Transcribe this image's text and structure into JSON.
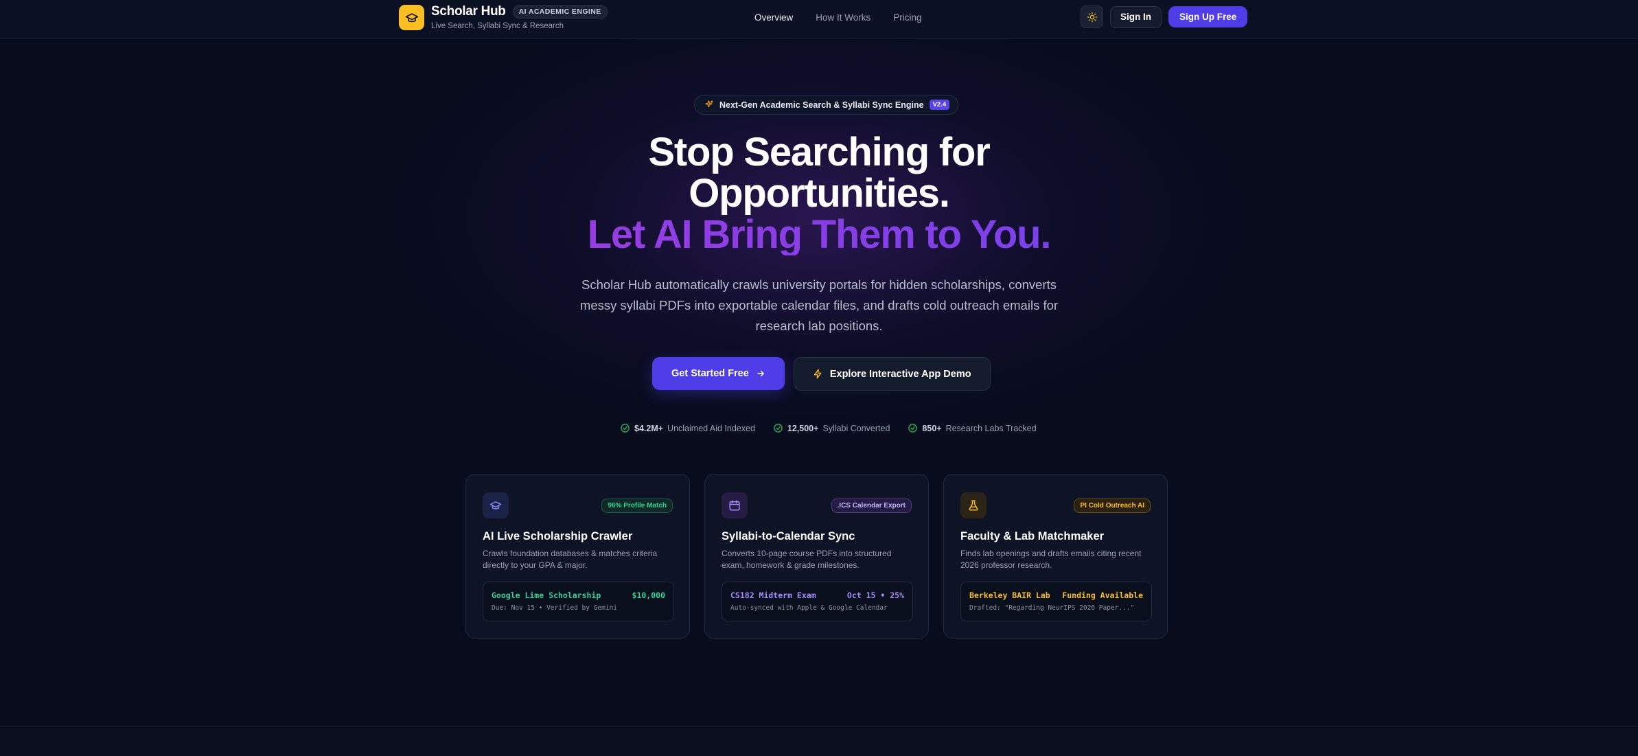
{
  "nav": {
    "brand_name": "Scholar Hub",
    "brand_badge": "AI ACADEMIC ENGINE",
    "brand_tagline": "Live Search, Syllabi Sync & Research",
    "links": [
      "Overview",
      "How It Works",
      "Pricing"
    ],
    "active_link": "Overview",
    "sign_in": "Sign In",
    "sign_up": "Sign Up Free"
  },
  "hero": {
    "pill_text": "Next-Gen Academic Search & Syllabi Sync Engine",
    "pill_version": "V2.4",
    "title_line1": "Stop Searching for",
    "title_line2": "Opportunities.",
    "title_line3": "Let AI Bring Them to You.",
    "subtitle": "Scholar Hub automatically crawls university portals for hidden scholarships, converts messy syllabi PDFs into exportable calendar files, and drafts cold outreach emails for research lab positions.",
    "cta_primary": "Get Started Free",
    "cta_secondary": "Explore Interactive App Demo"
  },
  "stats": [
    {
      "value": "$4.2M+",
      "label": "Unclaimed Aid Indexed"
    },
    {
      "value": "12,500+",
      "label": "Syllabi Converted"
    },
    {
      "value": "850+",
      "label": "Research Labs Tracked"
    }
  ],
  "cards": [
    {
      "icon": "graduation-cap-icon",
      "badge": "96% Profile Match",
      "title": "AI Live Scholarship Crawler",
      "desc": "Crawls foundation databases & matches criteria directly to your GPA & major.",
      "snippet_left": "Google Lime Scholarship",
      "snippet_right": "$10,000",
      "snippet_sub": "Due: Nov 15 • Verified by Gemini",
      "accent": "#34d399"
    },
    {
      "icon": "calendar-icon",
      "badge": ".ICS Calendar Export",
      "title": "Syllabi-to-Calendar Sync",
      "desc": "Converts 10-page course PDFs into structured exam, homework & grade milestones.",
      "snippet_left": "CS182 Midterm Exam",
      "snippet_right": "Oct 15 • 25%",
      "snippet_sub": "Auto-synced with Apple & Google Calendar",
      "accent": "#a78bfa"
    },
    {
      "icon": "flask-icon",
      "badge": "PI Cold Outreach AI",
      "title": "Faculty & Lab Matchmaker",
      "desc": "Finds lab openings and drafts emails citing recent 2026 professor research.",
      "snippet_left": "Berkeley BAIR Lab",
      "snippet_right": "Funding Available",
      "snippet_sub": "Drafted: \"Regarding NeurIPS 2026 Paper...\"",
      "accent": "#fbbf24"
    }
  ],
  "colors": {
    "background": "#080c1d",
    "primary": "#4f3ee8",
    "brand_yellow": "#fbbf24",
    "gradient_start": "#c13bd6",
    "gradient_end": "#5b48ef"
  }
}
